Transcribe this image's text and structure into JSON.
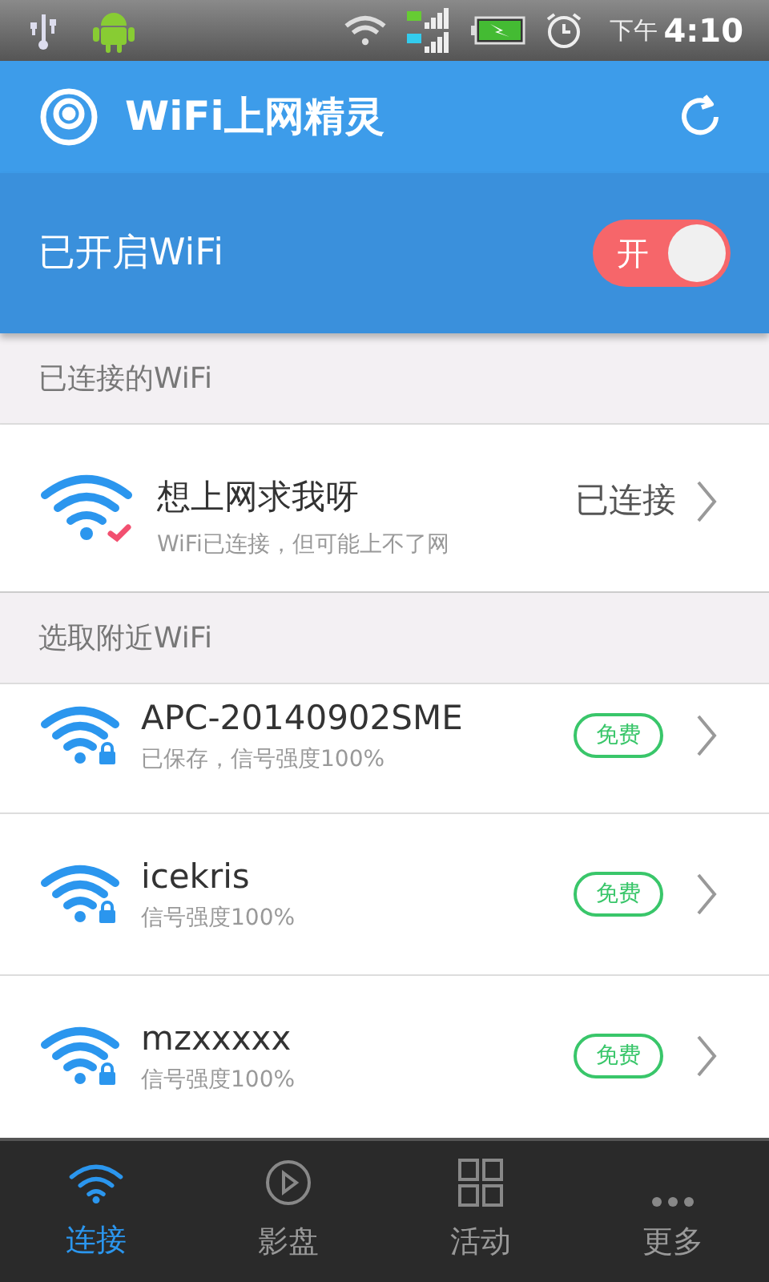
{
  "status_bar": {
    "time_period": "下午",
    "time": "4:10"
  },
  "header": {
    "title": "WiFi上网精灵"
  },
  "wifi_toggle": {
    "label": "已开启WiFi",
    "on": true,
    "on_text": "开"
  },
  "connected_section": {
    "heading": "已连接的WiFi",
    "network": {
      "name": "想上网求我呀",
      "subtitle": "WiFi已连接，但可能上不了网",
      "status": "已连接"
    }
  },
  "nearby_section": {
    "heading": "选取附近WiFi",
    "networks": [
      {
        "name": "APC-20140902SME",
        "subtitle": "已保存，信号强度100%",
        "badge": "免费",
        "locked": true
      },
      {
        "name": "icekris",
        "subtitle": "信号强度100%",
        "badge": "免费",
        "locked": true
      },
      {
        "name": "mzxxxxx",
        "subtitle": "信号强度100%",
        "badge": "免费",
        "locked": true
      }
    ]
  },
  "bottom_nav": [
    {
      "label": "连接",
      "kind": "wifi",
      "selected": true
    },
    {
      "label": "影盘",
      "kind": "play",
      "selected": false
    },
    {
      "label": "活动",
      "kind": "grid",
      "selected": false
    },
    {
      "label": "更多",
      "kind": "more",
      "selected": false
    }
  ]
}
